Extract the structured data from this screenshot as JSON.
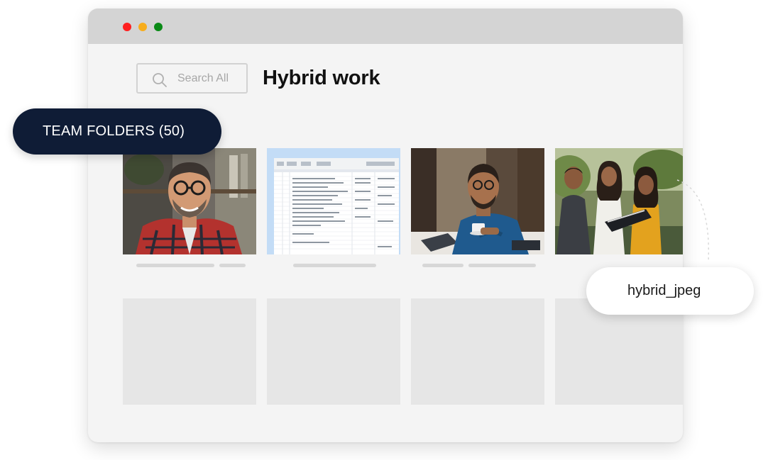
{
  "window": {
    "controls": [
      "close-dot",
      "minimize-dot",
      "maximize-dot"
    ]
  },
  "search": {
    "placeholder": "Search All",
    "icon": "search-icon"
  },
  "page_title": "Hybrid work",
  "team_folders_badge": "TEAM FOLDERS (50)",
  "file_label": "hybrid_jpeg",
  "thumbnails": [
    {
      "name": "thumbnail-man-glasses-photo",
      "kind": "photo"
    },
    {
      "name": "thumbnail-spreadsheet",
      "kind": "spreadsheet"
    },
    {
      "name": "thumbnail-man-coffee-photo",
      "kind": "photo"
    },
    {
      "name": "thumbnail-team-meeting-photo",
      "kind": "photo"
    }
  ],
  "colors": {
    "titlebar": "#d4d4d4",
    "window_bg": "#f4f4f4",
    "close": "#ff1f1f",
    "minimize": "#f7ad1c",
    "maximize": "#0a8a16",
    "team_pill_bg": "#0f1c36",
    "spreadsheet_bg": "#c3dcf6"
  }
}
